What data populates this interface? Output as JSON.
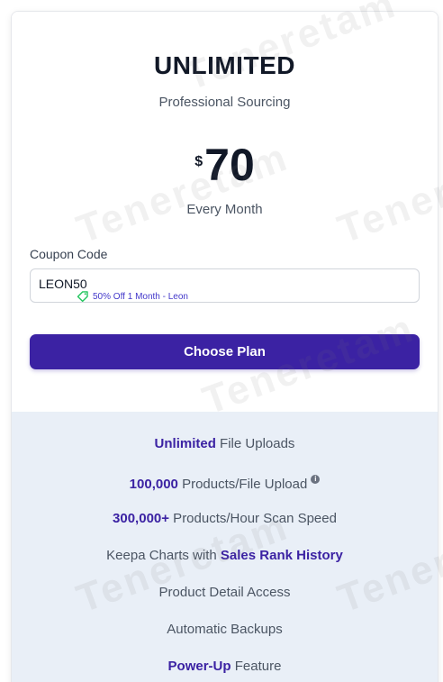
{
  "plan": {
    "name": "UNLIMITED",
    "subtitle": "Professional Sourcing",
    "currency": "$",
    "price": "70",
    "period": "Every Month"
  },
  "coupon": {
    "label": "Coupon Code",
    "value": "LEON50",
    "discount_note": "50% Off 1 Month - Leon"
  },
  "cta": {
    "label": "Choose Plan"
  },
  "features": [
    {
      "highlight": "Unlimited",
      "text": " File Uploads"
    },
    {
      "highlight": "100,000",
      "text": " Products/File Upload"
    },
    {
      "highlight": "300,000+",
      "text": " Products/Hour Scan Speed"
    },
    {
      "text": "Keepa Charts with ",
      "highlight": "Sales Rank History"
    },
    {
      "text": "Product Detail Access"
    },
    {
      "text": "Automatic Backups"
    },
    {
      "highlight": "Power-Up",
      "text": " Feature"
    }
  ],
  "watermark": {
    "text": "Teneretam"
  },
  "colors": {
    "accent": "#3b22a3",
    "features_bg": "#e9eff7",
    "coupon_tag": "#22c55e"
  },
  "icons": {
    "coupon_tag": "tag-icon",
    "info": "info-icon"
  }
}
